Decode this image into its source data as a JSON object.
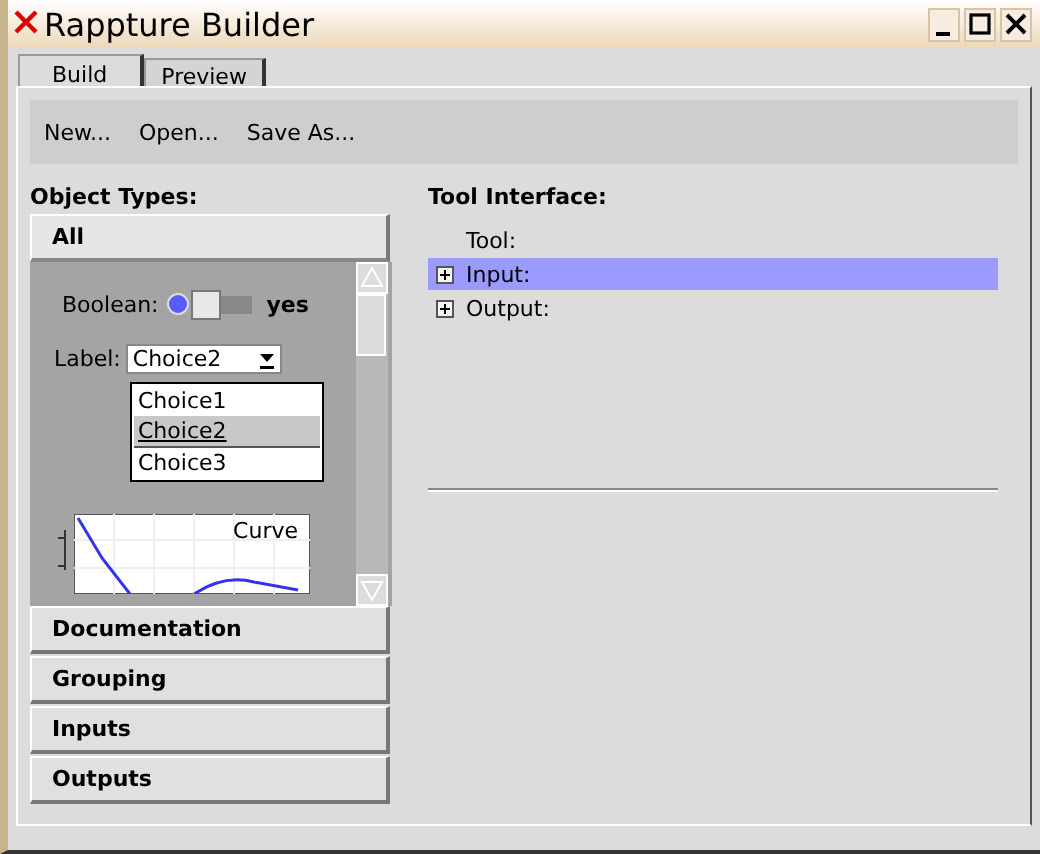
{
  "window": {
    "title": "Rappture Builder"
  },
  "tabs": [
    {
      "label": "Build",
      "selected": true
    },
    {
      "label": "Preview",
      "selected": false
    }
  ],
  "toolbar": [
    "New...",
    "Open...",
    "Save As..."
  ],
  "object_types": {
    "heading": "Object Types:",
    "groups": [
      {
        "label": "All",
        "expanded": true
      },
      {
        "label": "Documentation",
        "expanded": false
      },
      {
        "label": "Grouping",
        "expanded": false
      },
      {
        "label": "Inputs",
        "expanded": false
      },
      {
        "label": "Outputs",
        "expanded": false
      }
    ],
    "preview": {
      "boolean": {
        "label": "Boolean:",
        "on": true,
        "value": "yes"
      },
      "choice": {
        "label": "Label:",
        "value": "Choice2",
        "options": [
          {
            "label": "Choice1",
            "selected": false
          },
          {
            "label": "Choice2",
            "selected": true
          },
          {
            "label": "Choice3",
            "selected": false
          }
        ]
      },
      "plot": {
        "title": "Curve"
      }
    }
  },
  "tool_interface": {
    "heading": "Tool Interface:",
    "items": [
      {
        "label": "Tool:",
        "kind": "leaf",
        "selected": false
      },
      {
        "label": "Input:",
        "kind": "group",
        "selected": true
      },
      {
        "label": "Output:",
        "kind": "group",
        "selected": false
      }
    ]
  }
}
